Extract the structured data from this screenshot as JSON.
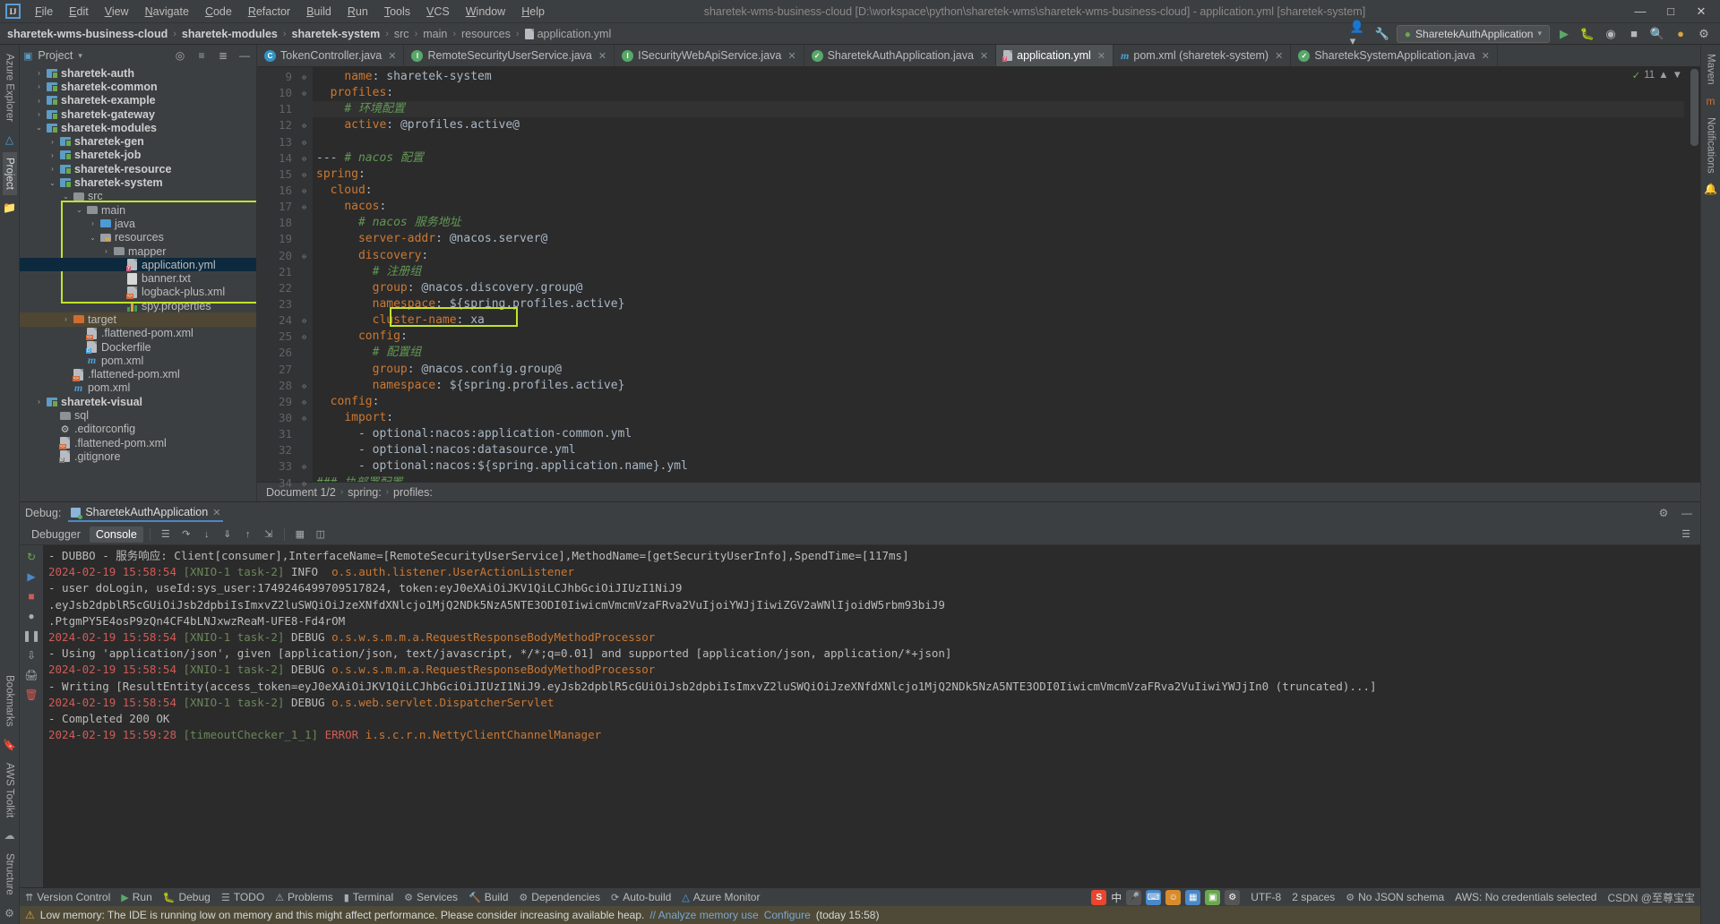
{
  "titlebar": {
    "logo": "IJ",
    "menus": [
      "File",
      "Edit",
      "View",
      "Navigate",
      "Code",
      "Refactor",
      "Build",
      "Run",
      "Tools",
      "VCS",
      "Window",
      "Help"
    ],
    "window_title": "sharetek-wms-business-cloud [D:\\workspace\\python\\sharetek-wms\\sharetek-wms-business-cloud] - application.yml [sharetek-system]",
    "minimize": "—",
    "maximize": "□",
    "close": "✕"
  },
  "navbar": {
    "crumbs": [
      "sharetek-wms-business-cloud",
      "sharetek-modules",
      "sharetek-system",
      "src",
      "main",
      "resources",
      "application.yml"
    ],
    "separator": "›",
    "run_config": "SharetekAuthApplication",
    "run_label": "Run",
    "debug_label": "Debug",
    "search_label": "Search Everywhere",
    "settings_label": "Settings"
  },
  "left_rail": {
    "azure_explorer": "Azure Explorer",
    "project": "Project",
    "bookmarks": "Bookmarks",
    "aws_toolkit": "AWS Toolkit",
    "structure": "Structure"
  },
  "right_rail": {
    "maven": "Maven",
    "notifications": "Notifications"
  },
  "project_panel": {
    "title": "Project",
    "tree": [
      {
        "indent": 1,
        "arrow": "›",
        "icon": "module",
        "label": "sharetek-auth",
        "bold": true
      },
      {
        "indent": 1,
        "arrow": "›",
        "icon": "module",
        "label": "sharetek-common",
        "bold": true
      },
      {
        "indent": 1,
        "arrow": "›",
        "icon": "module",
        "label": "sharetek-example",
        "bold": true
      },
      {
        "indent": 1,
        "arrow": "›",
        "icon": "module",
        "label": "sharetek-gateway",
        "bold": true
      },
      {
        "indent": 1,
        "arrow": "⌄",
        "icon": "module",
        "label": "sharetek-modules",
        "bold": true
      },
      {
        "indent": 2,
        "arrow": "›",
        "icon": "module",
        "label": "sharetek-gen",
        "bold": true
      },
      {
        "indent": 2,
        "arrow": "›",
        "icon": "module",
        "label": "sharetek-job",
        "bold": true
      },
      {
        "indent": 2,
        "arrow": "›",
        "icon": "module",
        "label": "sharetek-resource",
        "bold": true
      },
      {
        "indent": 2,
        "arrow": "⌄",
        "icon": "module",
        "label": "sharetek-system",
        "bold": true
      },
      {
        "indent": 3,
        "arrow": "⌄",
        "icon": "folder",
        "label": "src",
        "bold": false
      },
      {
        "indent": 4,
        "arrow": "⌄",
        "icon": "folder",
        "label": "main",
        "bold": false
      },
      {
        "indent": 5,
        "arrow": "›",
        "icon": "folder-src",
        "label": "java",
        "bold": false
      },
      {
        "indent": 5,
        "arrow": "⌄",
        "icon": "folder-res",
        "label": "resources",
        "bold": false
      },
      {
        "indent": 6,
        "arrow": "›",
        "icon": "folder",
        "label": "mapper",
        "bold": false
      },
      {
        "indent": 7,
        "arrow": "",
        "icon": "yml",
        "label": "application.yml",
        "bold": false,
        "selected": true
      },
      {
        "indent": 7,
        "arrow": "",
        "icon": "txt",
        "label": "banner.txt",
        "bold": false
      },
      {
        "indent": 7,
        "arrow": "",
        "icon": "xml",
        "label": "logback-plus.xml",
        "bold": false
      },
      {
        "indent": 7,
        "arrow": "",
        "icon": "prop",
        "label": "spy.properties",
        "bold": false
      },
      {
        "indent": 3,
        "arrow": "›",
        "icon": "folder-orange",
        "label": "target",
        "bold": false,
        "target": true
      },
      {
        "indent": 4,
        "arrow": "",
        "icon": "xml",
        "label": ".flattened-pom.xml",
        "bold": false
      },
      {
        "indent": 4,
        "arrow": "",
        "icon": "docker",
        "label": "Dockerfile",
        "bold": false
      },
      {
        "indent": 4,
        "arrow": "",
        "icon": "maven",
        "label": "pom.xml",
        "bold": false
      },
      {
        "indent": 3,
        "arrow": "",
        "icon": "xml",
        "label": ".flattened-pom.xml",
        "bold": false
      },
      {
        "indent": 3,
        "arrow": "",
        "icon": "maven",
        "label": "pom.xml",
        "bold": false
      },
      {
        "indent": 1,
        "arrow": "›",
        "icon": "module",
        "label": "sharetek-visual",
        "bold": true
      },
      {
        "indent": 2,
        "arrow": "",
        "icon": "folder",
        "label": "sql",
        "bold": false
      },
      {
        "indent": 2,
        "arrow": "",
        "icon": "gear",
        "label": ".editorconfig",
        "bold": false
      },
      {
        "indent": 2,
        "arrow": "",
        "icon": "xml",
        "label": ".flattened-pom.xml",
        "bold": false
      },
      {
        "indent": 2,
        "arrow": "",
        "icon": "git",
        "label": ".gitignore",
        "bold": false
      }
    ]
  },
  "editor": {
    "tabs": [
      {
        "label": "TokenController.java",
        "icon": "class",
        "active": false
      },
      {
        "label": "RemoteSecurityUserService.java",
        "icon": "interface",
        "active": false
      },
      {
        "label": "ISecurityWebApiService.java",
        "icon": "interface",
        "active": false
      },
      {
        "label": "SharetekAuthApplication.java",
        "icon": "spring",
        "active": false
      },
      {
        "label": "application.yml",
        "icon": "yml",
        "active": true
      },
      {
        "label": "pom.xml (sharetek-system)",
        "icon": "maven",
        "active": false
      },
      {
        "label": "SharetekSystemApplication.java",
        "icon": "spring",
        "active": false
      }
    ],
    "close_glyph": "✕",
    "inspection_count": "11",
    "lines": [
      {
        "num": 9,
        "fold": "⊖",
        "indent": 4,
        "segments": [
          {
            "t": "name",
            "c": "key"
          },
          {
            "t": ": ",
            "c": "plain"
          },
          {
            "t": "sharetek-system",
            "c": "val"
          }
        ]
      },
      {
        "num": 10,
        "fold": "⊖",
        "indent": 2,
        "segments": [
          {
            "t": "profiles",
            "c": "key"
          },
          {
            "t": ":",
            "c": "plain"
          }
        ]
      },
      {
        "num": 11,
        "fold": "",
        "indent": 4,
        "current": true,
        "segments": [
          {
            "t": "# 环境配置",
            "c": "cmt"
          }
        ]
      },
      {
        "num": 12,
        "fold": "⊖",
        "indent": 4,
        "segments": [
          {
            "t": "active",
            "c": "key"
          },
          {
            "t": ": ",
            "c": "plain"
          },
          {
            "t": "@profiles.active@",
            "c": "val"
          }
        ]
      },
      {
        "num": 13,
        "fold": "⊖",
        "indent": 0,
        "segments": []
      },
      {
        "num": 14,
        "fold": "⊖",
        "indent": 0,
        "segments": [
          {
            "t": "--- ",
            "c": "plain"
          },
          {
            "t": "# nacos 配置",
            "c": "cmt"
          }
        ]
      },
      {
        "num": 15,
        "fold": "⊖",
        "indent": 0,
        "segments": [
          {
            "t": "spring",
            "c": "key"
          },
          {
            "t": ":",
            "c": "plain"
          }
        ]
      },
      {
        "num": 16,
        "fold": "⊖",
        "indent": 2,
        "segments": [
          {
            "t": "cloud",
            "c": "key"
          },
          {
            "t": ":",
            "c": "plain"
          }
        ]
      },
      {
        "num": 17,
        "fold": "⊖",
        "indent": 4,
        "segments": [
          {
            "t": "nacos",
            "c": "key"
          },
          {
            "t": ":",
            "c": "plain"
          }
        ]
      },
      {
        "num": 18,
        "fold": "",
        "indent": 6,
        "segments": [
          {
            "t": "# nacos 服务地址",
            "c": "cmt"
          }
        ]
      },
      {
        "num": 19,
        "fold": "",
        "indent": 6,
        "segments": [
          {
            "t": "server-addr",
            "c": "key"
          },
          {
            "t": ": ",
            "c": "plain"
          },
          {
            "t": "@nacos.server@",
            "c": "val"
          }
        ]
      },
      {
        "num": 20,
        "fold": "⊖",
        "indent": 6,
        "segments": [
          {
            "t": "discovery",
            "c": "key"
          },
          {
            "t": ":",
            "c": "plain"
          }
        ]
      },
      {
        "num": 21,
        "fold": "",
        "indent": 8,
        "segments": [
          {
            "t": "# 注册组",
            "c": "cmt"
          }
        ]
      },
      {
        "num": 22,
        "fold": "",
        "indent": 8,
        "segments": [
          {
            "t": "group",
            "c": "key"
          },
          {
            "t": ": ",
            "c": "plain"
          },
          {
            "t": "@nacos.discovery.group@",
            "c": "val"
          }
        ]
      },
      {
        "num": 23,
        "fold": "",
        "indent": 8,
        "segments": [
          {
            "t": "namespace",
            "c": "key"
          },
          {
            "t": ": ",
            "c": "plain"
          },
          {
            "t": "${spring.profiles.active}",
            "c": "val"
          }
        ]
      },
      {
        "num": 24,
        "fold": "⊖",
        "indent": 8,
        "segments": [
          {
            "t": "cluster-name",
            "c": "key"
          },
          {
            "t": ": ",
            "c": "plain"
          },
          {
            "t": "xa",
            "c": "val"
          }
        ]
      },
      {
        "num": 25,
        "fold": "⊖",
        "indent": 6,
        "segments": [
          {
            "t": "config",
            "c": "key"
          },
          {
            "t": ":",
            "c": "plain"
          }
        ]
      },
      {
        "num": 26,
        "fold": "",
        "indent": 8,
        "segments": [
          {
            "t": "# 配置组",
            "c": "cmt"
          }
        ]
      },
      {
        "num": 27,
        "fold": "",
        "indent": 8,
        "segments": [
          {
            "t": "group",
            "c": "key"
          },
          {
            "t": ": ",
            "c": "plain"
          },
          {
            "t": "@nacos.config.group@",
            "c": "val"
          }
        ]
      },
      {
        "num": 28,
        "fold": "⊖",
        "indent": 8,
        "segments": [
          {
            "t": "namespace",
            "c": "key"
          },
          {
            "t": ": ",
            "c": "plain"
          },
          {
            "t": "${spring.profiles.active}",
            "c": "val"
          }
        ]
      },
      {
        "num": 29,
        "fold": "⊖",
        "indent": 2,
        "segments": [
          {
            "t": "config",
            "c": "key"
          },
          {
            "t": ":",
            "c": "plain"
          }
        ]
      },
      {
        "num": 30,
        "fold": "⊖",
        "indent": 4,
        "segments": [
          {
            "t": "import",
            "c": "key"
          },
          {
            "t": ":",
            "c": "plain"
          }
        ]
      },
      {
        "num": 31,
        "fold": "",
        "indent": 6,
        "segments": [
          {
            "t": "- ",
            "c": "plain"
          },
          {
            "t": "optional:nacos:application-common.yml",
            "c": "val"
          }
        ]
      },
      {
        "num": 32,
        "fold": "",
        "indent": 6,
        "segments": [
          {
            "t": "- ",
            "c": "plain"
          },
          {
            "t": "optional:nacos:datasource.yml",
            "c": "val"
          }
        ]
      },
      {
        "num": 33,
        "fold": "⊖",
        "indent": 6,
        "segments": [
          {
            "t": "- ",
            "c": "plain"
          },
          {
            "t": "optional:nacos:${spring.application.name}.yml",
            "c": "val"
          }
        ]
      },
      {
        "num": 34,
        "fold": "⊖",
        "indent": 0,
        "segments": [
          {
            "t": "### 执部署配置",
            "c": "cmt"
          }
        ]
      }
    ],
    "breadcrumb": [
      "Document 1/2",
      "spring:",
      "profiles:"
    ],
    "breadcrumb_sep": "›"
  },
  "debug": {
    "label": "Debug:",
    "session": "SharetekAuthApplication",
    "close_glyph": "✕",
    "tabs": [
      "Debugger",
      "Console"
    ],
    "active_tab": "Console",
    "console_lines": [
      {
        "parts": [
          {
            "t": "- DUBBO - 服务响应: Client[consumer],InterfaceName=[RemoteSecurityUserService],MethodName=[getSecurityUserInfo],SpendTime=[117ms]",
            "c": "ctext"
          }
        ]
      },
      {
        "parts": [
          {
            "t": "2024-02-19 15:58:54 ",
            "c": "ts"
          },
          {
            "t": "[XNIO-1 task-2] ",
            "c": "thr"
          },
          {
            "t": "INFO  ",
            "c": "lvl-info"
          },
          {
            "t": "o.s.auth.listener.UserActionListener",
            "c": "logger"
          }
        ]
      },
      {
        "parts": [
          {
            "t": "- user doLogin, useId:sys_user:1749246499709517824, token:eyJ0eXAiOiJKV1QiLCJhbGciOiJIUzI1NiJ9",
            "c": "ctext"
          }
        ]
      },
      {
        "parts": [
          {
            "t": ".eyJsb2dpblR5cGUiOiJsb2dpbiIsImxvZ2luSWQiOiJzeXNfdXNlcjo1MjQ2NDk5NzA5NTE3ODI0IiwicmVmcmVzaFRva2VuIjoiYWJjIiwiZGV2aWNlIjoidW5rbm93biJ9",
            "c": "ctext"
          }
        ]
      },
      {
        "parts": [
          {
            "t": ".PtgmPY5E4osP9zQn4CF4bLNJxwzReaM-UFE8-Fd4rOM",
            "c": "ctext"
          }
        ]
      },
      {
        "parts": [
          {
            "t": "2024-02-19 15:58:54 ",
            "c": "ts"
          },
          {
            "t": "[XNIO-1 task-2] ",
            "c": "thr"
          },
          {
            "t": "DEBUG ",
            "c": "lvl-dbg"
          },
          {
            "t": "o.s.w.s.m.m.a.RequestResponseBodyMethodProcessor",
            "c": "logger"
          }
        ]
      },
      {
        "parts": [
          {
            "t": "- Using 'application/json', given [application/json, text/javascript, */*;q=0.01] and supported [application/json, application/*+json]",
            "c": "ctext"
          }
        ]
      },
      {
        "parts": [
          {
            "t": "2024-02-19 15:58:54 ",
            "c": "ts"
          },
          {
            "t": "[XNIO-1 task-2] ",
            "c": "thr"
          },
          {
            "t": "DEBUG ",
            "c": "lvl-dbg"
          },
          {
            "t": "o.s.w.s.m.m.a.RequestResponseBodyMethodProcessor",
            "c": "logger"
          }
        ]
      },
      {
        "parts": [
          {
            "t": "- Writing [ResultEntity(access_token=eyJ0eXAiOiJKV1QiLCJhbGciOiJIUzI1NiJ9.eyJsb2dpblR5cGUiOiJsb2dpbiIsImxvZ2luSWQiOiJzeXNfdXNlcjo1MjQ2NDk5NzA5NTE3ODI0IiwicmVmcmVzaFRva2VuIiwiYWJjIn0 (truncated)...]",
            "c": "ctext"
          }
        ]
      },
      {
        "parts": [
          {
            "t": "2024-02-19 15:58:54 ",
            "c": "ts"
          },
          {
            "t": "[XNIO-1 task-2] ",
            "c": "thr"
          },
          {
            "t": "DEBUG ",
            "c": "lvl-dbg"
          },
          {
            "t": "o.s.web.servlet.DispatcherServlet",
            "c": "logger"
          }
        ]
      },
      {
        "parts": [
          {
            "t": "- Completed 200 OK",
            "c": "ctext"
          }
        ]
      },
      {
        "parts": [
          {
            "t": "2024-02-19 15:59:28 ",
            "c": "ts"
          },
          {
            "t": "[timeoutChecker_1_1] ",
            "c": "thr"
          },
          {
            "t": "ERROR ",
            "c": "lvl-err"
          },
          {
            "t": "i.s.c.r.n.NettyClientChannelManager",
            "c": "logger"
          }
        ]
      }
    ]
  },
  "statusbar": {
    "items": [
      "Version Control",
      "Run",
      "Debug",
      "TODO",
      "Problems",
      "Terminal",
      "Services",
      "Build",
      "Dependencies",
      "Auto-build",
      "Azure Monitor"
    ],
    "encoding": "UTF-8",
    "indent": "2 spaces",
    "schema": "No JSON schema",
    "aws": "AWS: No credentials selected",
    "csdn": "CSDN @至尊宝宝"
  },
  "warning": {
    "icon": "⚠",
    "text": "Low memory: The IDE is running low on memory and this might affect performance. Please consider increasing available heap.",
    "link1": "// Analyze memory use",
    "link2": "Configure",
    "suffix": "(today 15:58)"
  },
  "tray": {
    "sogou": "S",
    "ime": "中",
    "icons": [
      "mic-icon",
      "keyboard-icon",
      "emoji-icon",
      "apps-icon",
      "image-icon",
      "settings-icon"
    ]
  },
  "colors": {
    "accent": "#4a88c7",
    "highlight": "#c2e32c",
    "selection": "#0d293e",
    "error": "#cf5b56",
    "comment": "#629755",
    "key": "#cc7832"
  }
}
